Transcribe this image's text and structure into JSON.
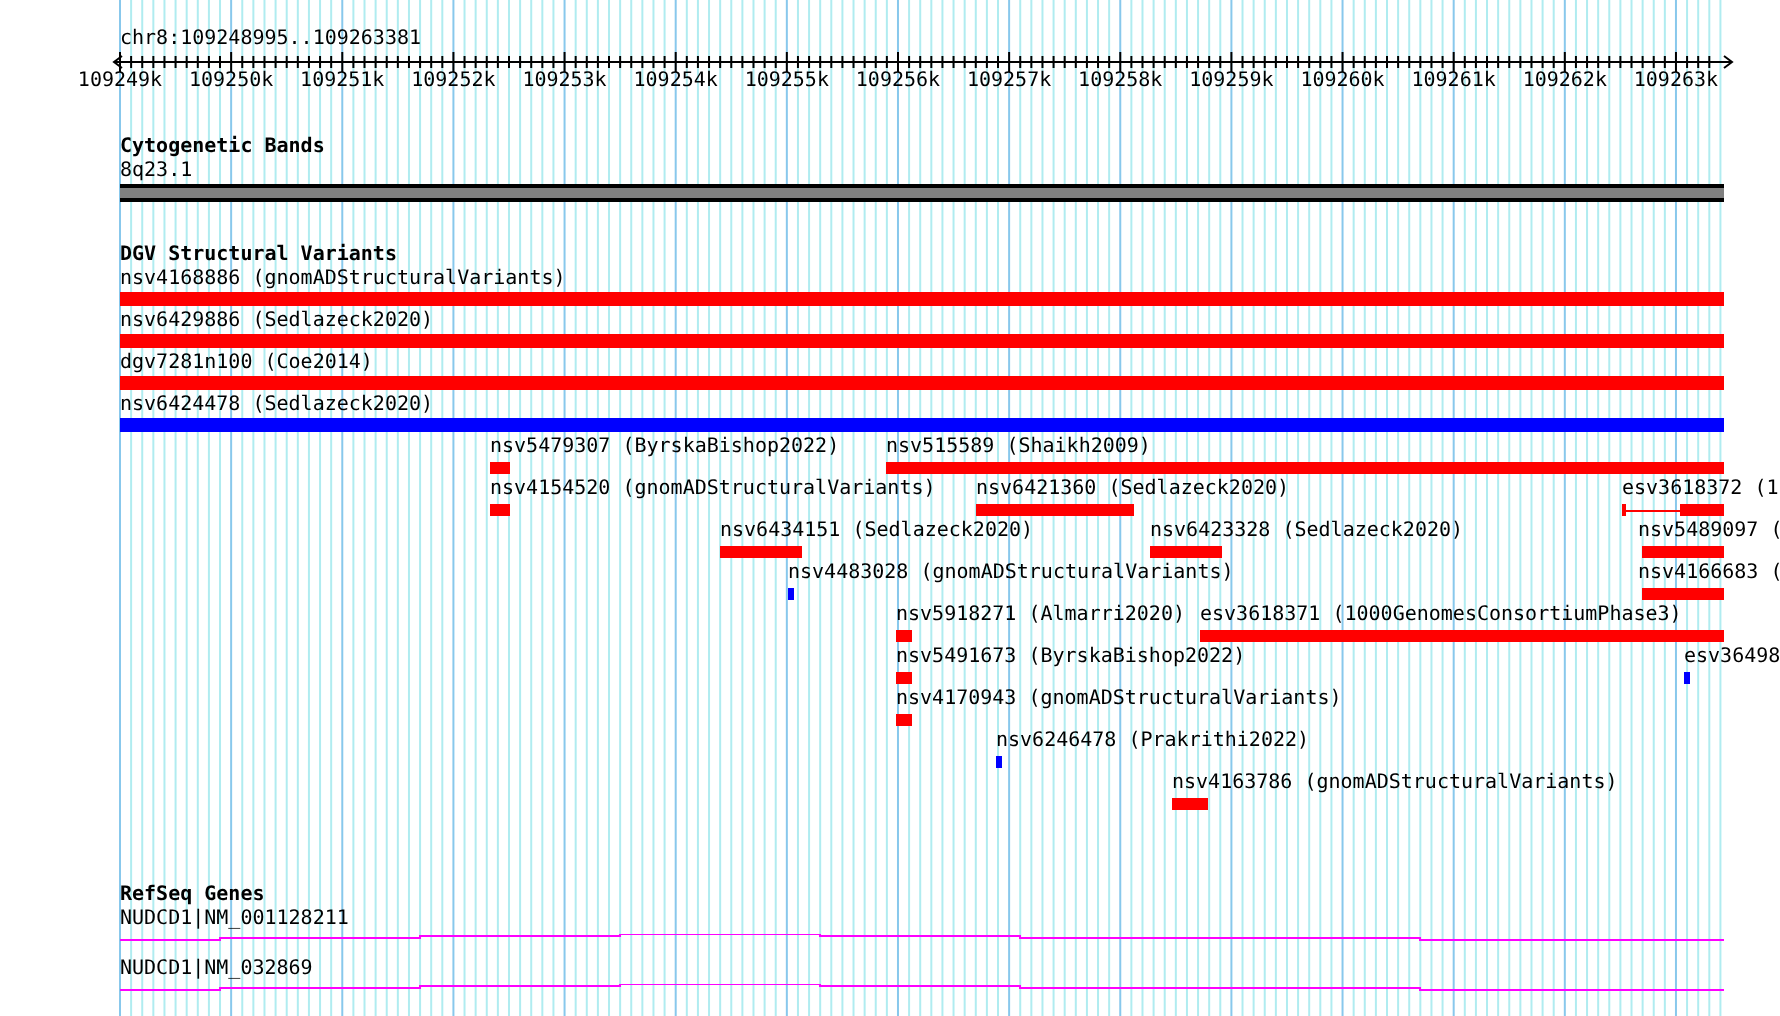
{
  "locus": "chr8:109248995..109263381",
  "axis": {
    "ticks": [
      "109249k",
      "109250k",
      "109251k",
      "109252k",
      "109253k",
      "109254k",
      "109255k",
      "109256k",
      "109257k",
      "109258k",
      "109259k",
      "109260k",
      "109261k",
      "109262k",
      "109263k"
    ]
  },
  "tracks": [
    {
      "title": "Cytogenetic Bands",
      "kind": "bands",
      "features": [
        {
          "label": "8q23.1"
        }
      ]
    },
    {
      "title": "DGV Structural Variants",
      "kind": "variants",
      "features": [
        {
          "label": "nsv4168886 (gnomADStructuralVariants)",
          "color": "#ff0000",
          "kind": "bar"
        },
        {
          "label": "nsv6429886 (Sedlazeck2020)",
          "color": "#ff0000",
          "kind": "bar"
        },
        {
          "label": "dgv7281n100 (Coe2014)",
          "color": "#ff0000",
          "kind": "bar"
        },
        {
          "label": "nsv6424478 (Sedlazeck2020)",
          "color": "#0000ff",
          "kind": "bar"
        },
        {
          "label": "nsv5479307 (ByrskaBishop2022)",
          "color": "#ff0000",
          "kind": "bar"
        },
        {
          "label": "nsv515589 (Shaikh2009)",
          "color": "#ff0000",
          "kind": "bar"
        },
        {
          "label": "nsv4154520 (gnomADStructuralVariants)",
          "color": "#ff0000",
          "kind": "bar"
        },
        {
          "label": "nsv6421360 (Sedlazeck2020)",
          "color": "#ff0000",
          "kind": "bar"
        },
        {
          "label": "esv3618372 (1",
          "color": "#ff0000",
          "kind": "split"
        },
        {
          "label": "nsv6434151 (Sedlazeck2020)",
          "color": "#ff0000",
          "kind": "bar"
        },
        {
          "label": "nsv6423328 (Sedlazeck2020)",
          "color": "#ff0000",
          "kind": "bar"
        },
        {
          "label": "nsv5489097 (",
          "color": "#ff0000",
          "kind": "bar"
        },
        {
          "label": "nsv4483028 (gnomADStructuralVariants)",
          "color": "#0000ff",
          "kind": "bar"
        },
        {
          "label": "nsv4166683 (",
          "color": "#ff0000",
          "kind": "bar"
        },
        {
          "label": "nsv5918271 (Almarri2020)",
          "color": "#ff0000",
          "kind": "bar"
        },
        {
          "label": "esv3618371 (1000GenomesConsortiumPhase3)",
          "color": "#ff0000",
          "kind": "bar"
        },
        {
          "label": "nsv5491673 (ByrskaBishop2022)",
          "color": "#ff0000",
          "kind": "bar"
        },
        {
          "label": "esv36498",
          "color": "#0000ff",
          "kind": "bar"
        },
        {
          "label": "nsv4170943 (gnomADStructuralVariants)",
          "color": "#ff0000",
          "kind": "bar"
        },
        {
          "label": "nsv6246478 (Prakrithi2022)",
          "color": "#0000ff",
          "kind": "bar"
        },
        {
          "label": "nsv4163786 (gnomADStructuralVariants)",
          "color": "#ff0000",
          "kind": "bar"
        }
      ]
    },
    {
      "title": "RefSeq Genes",
      "kind": "genes",
      "features": [
        {
          "label": "NUDCD1|NM_001128211"
        },
        {
          "label": "NUDCD1|NM_032869"
        }
      ]
    }
  ]
}
